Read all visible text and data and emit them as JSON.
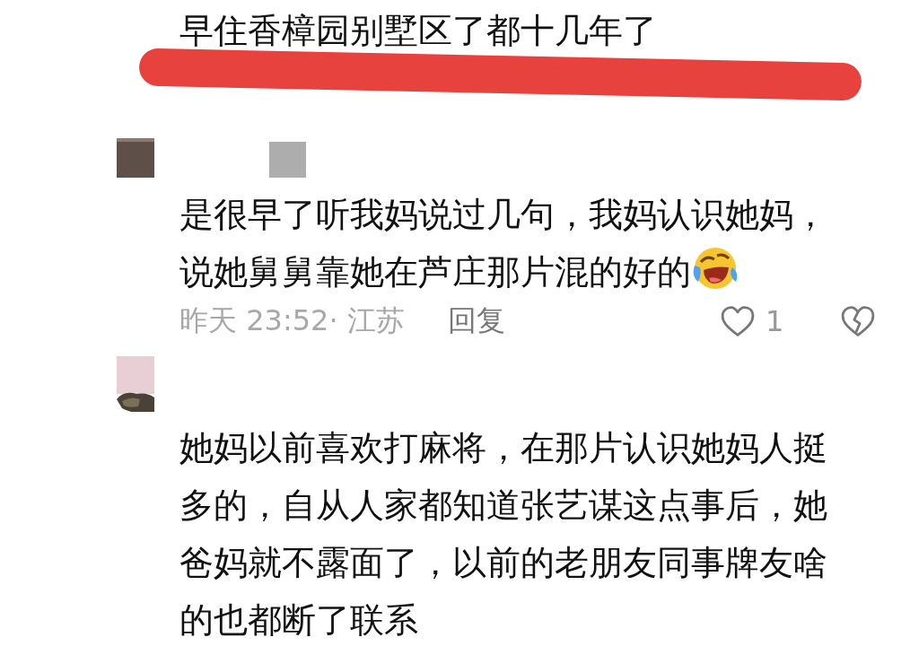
{
  "comments": [
    {
      "avatar": false,
      "name_hidden": false,
      "text": "早住香樟园别墅区了都十几年了",
      "emoji": false,
      "redacted": true
    },
    {
      "avatar": true,
      "name_hidden": true,
      "text": "是很早了听我妈说过几句，我妈认识她妈，说她舅舅靠她在芦庄那片混的好的",
      "emoji": true,
      "meta": "昨天 23:52· 江苏",
      "reply": "回复",
      "likes": "1",
      "redacted": false
    },
    {
      "avatar": true,
      "name_hidden": false,
      "text": "她妈以前喜欢打麻将，在那片认识她妈人挺多的，自从人家都知道张艺谋这点事后，她爸妈就不露面了，以前的老朋友同事牌友啥的也都断了联系",
      "emoji": false,
      "redacted": false
    }
  ]
}
